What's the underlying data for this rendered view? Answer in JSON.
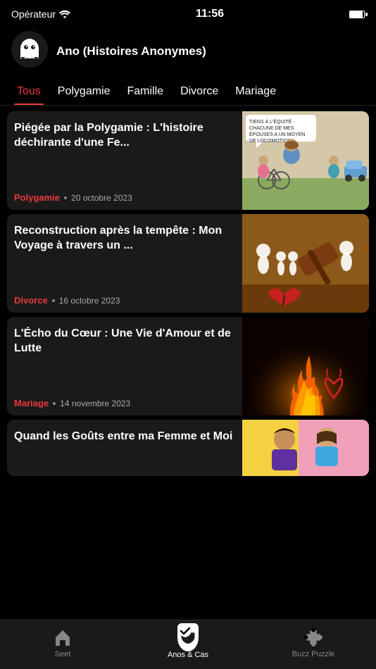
{
  "statusBar": {
    "operator": "Opérateur",
    "time": "11:56",
    "wifiIcon": "wifi-icon",
    "batteryIcon": "battery-icon"
  },
  "header": {
    "title": "Ano (Histoires Anonymes)",
    "ghostIcon": "ghost-icon"
  },
  "tabs": [
    {
      "id": "tous",
      "label": "Tous",
      "active": true
    },
    {
      "id": "polygamie",
      "label": "Polygamie",
      "active": false
    },
    {
      "id": "famille",
      "label": "Famille",
      "active": false
    },
    {
      "id": "divorce",
      "label": "Divorce",
      "active": false
    },
    {
      "id": "mariage",
      "label": "Mariage",
      "active": false
    }
  ],
  "cards": [
    {
      "id": "card-1",
      "title": "Piégée par la Polygamie : L'histoire déchirante d'une Fe...",
      "category": "Polygamie",
      "categoryClass": "polygamie",
      "date": "20 octobre 2023",
      "imageType": "cartoon",
      "speechBubble": "TIENS À L'ÉQUITÉ · CHACUNE DE MES ÉPOUSES A UN MOYEN DE LOCOMOTION..."
    },
    {
      "id": "card-2",
      "title": "Reconstruction après la tempête : Mon Voyage à travers un ...",
      "category": "Divorce",
      "categoryClass": "divorce",
      "date": "16 octobre 2023",
      "imageType": "divorce"
    },
    {
      "id": "card-3",
      "title": "L'Écho du Cœur : Une Vie d'Amour et de Lutte",
      "category": "Mariage",
      "categoryClass": "mariage",
      "date": "14 novembre 2023",
      "imageType": "fire"
    },
    {
      "id": "card-4",
      "title": "Quand les Goûts entre ma Femme et Moi",
      "category": "",
      "categoryClass": "",
      "date": "",
      "imageType": "couple"
    }
  ],
  "bottomNav": [
    {
      "id": "seet",
      "label": "Seet",
      "icon": "home-icon",
      "active": false
    },
    {
      "id": "anos-cas",
      "label": "Anos & Cas",
      "icon": "shield-check-icon",
      "active": true
    },
    {
      "id": "buzz-puzzle",
      "label": "Buzz Puzzle",
      "icon": "puzzle-icon",
      "active": false
    }
  ]
}
